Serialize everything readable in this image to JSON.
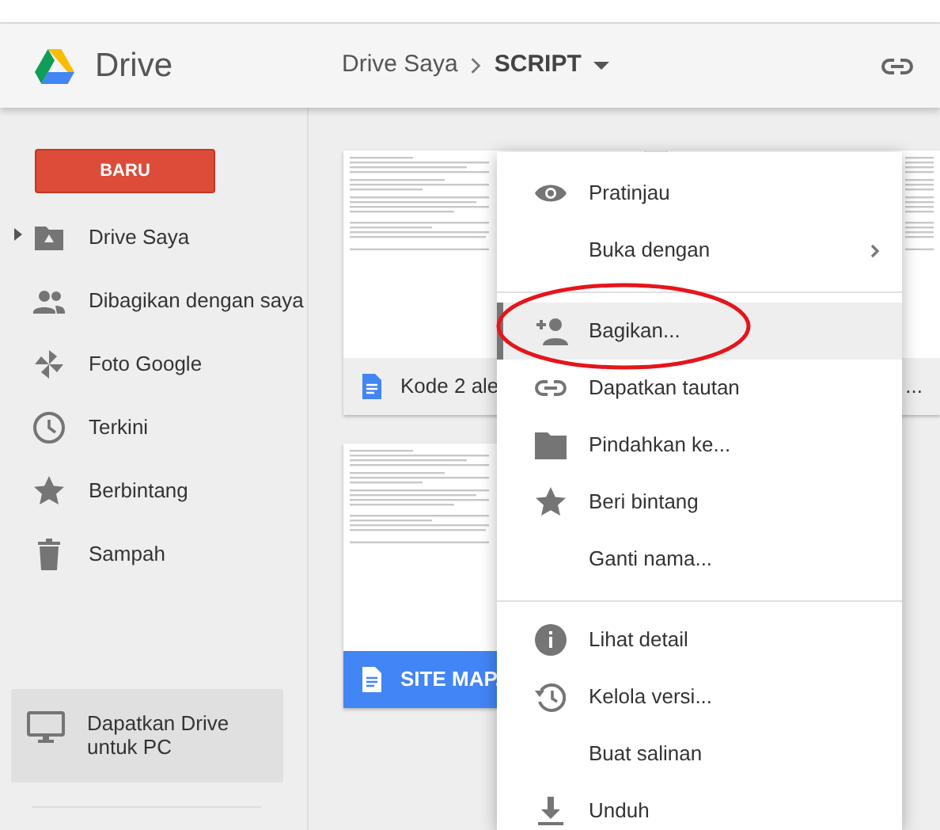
{
  "header": {
    "app_name": "Drive",
    "breadcrumb": [
      {
        "label": "Drive Saya",
        "current": false
      },
      {
        "label": "SCRIPT",
        "current": true
      }
    ]
  },
  "sidebar": {
    "new_button": "BARU",
    "items": [
      {
        "label": "Drive Saya",
        "expanded": false
      },
      {
        "label": "Dibagikan dengan saya"
      },
      {
        "label": "Foto Google"
      },
      {
        "label": "Terkini"
      },
      {
        "label": "Berbintang"
      },
      {
        "label": "Sampah"
      }
    ],
    "promo": "Dapatkan Drive untuk PC"
  },
  "files": [
    {
      "name": "Kode 2 ale",
      "selected": false
    },
    {
      "name": "...",
      "selected": false
    },
    {
      "name": "SITE MAP.",
      "selected": true
    }
  ],
  "context_menu": {
    "groups": [
      [
        {
          "label": "Pratinjau",
          "selected": false,
          "submenu": false
        },
        {
          "label": "Buka dengan",
          "selected": false,
          "submenu": true
        }
      ],
      [
        {
          "label": "Bagikan...",
          "selected": true,
          "submenu": false
        },
        {
          "label": "Dapatkan tautan",
          "selected": false,
          "submenu": false
        },
        {
          "label": "Pindahkan ke...",
          "selected": false,
          "submenu": false
        },
        {
          "label": "Beri bintang",
          "selected": false,
          "submenu": false
        },
        {
          "label": "Ganti nama...",
          "selected": false,
          "submenu": false
        }
      ],
      [
        {
          "label": "Lihat detail",
          "selected": false,
          "submenu": false
        },
        {
          "label": "Kelola versi...",
          "selected": false,
          "submenu": false
        },
        {
          "label": "Buat salinan",
          "selected": false,
          "submenu": false
        },
        {
          "label": "Unduh",
          "selected": false,
          "submenu": false
        }
      ]
    ]
  }
}
